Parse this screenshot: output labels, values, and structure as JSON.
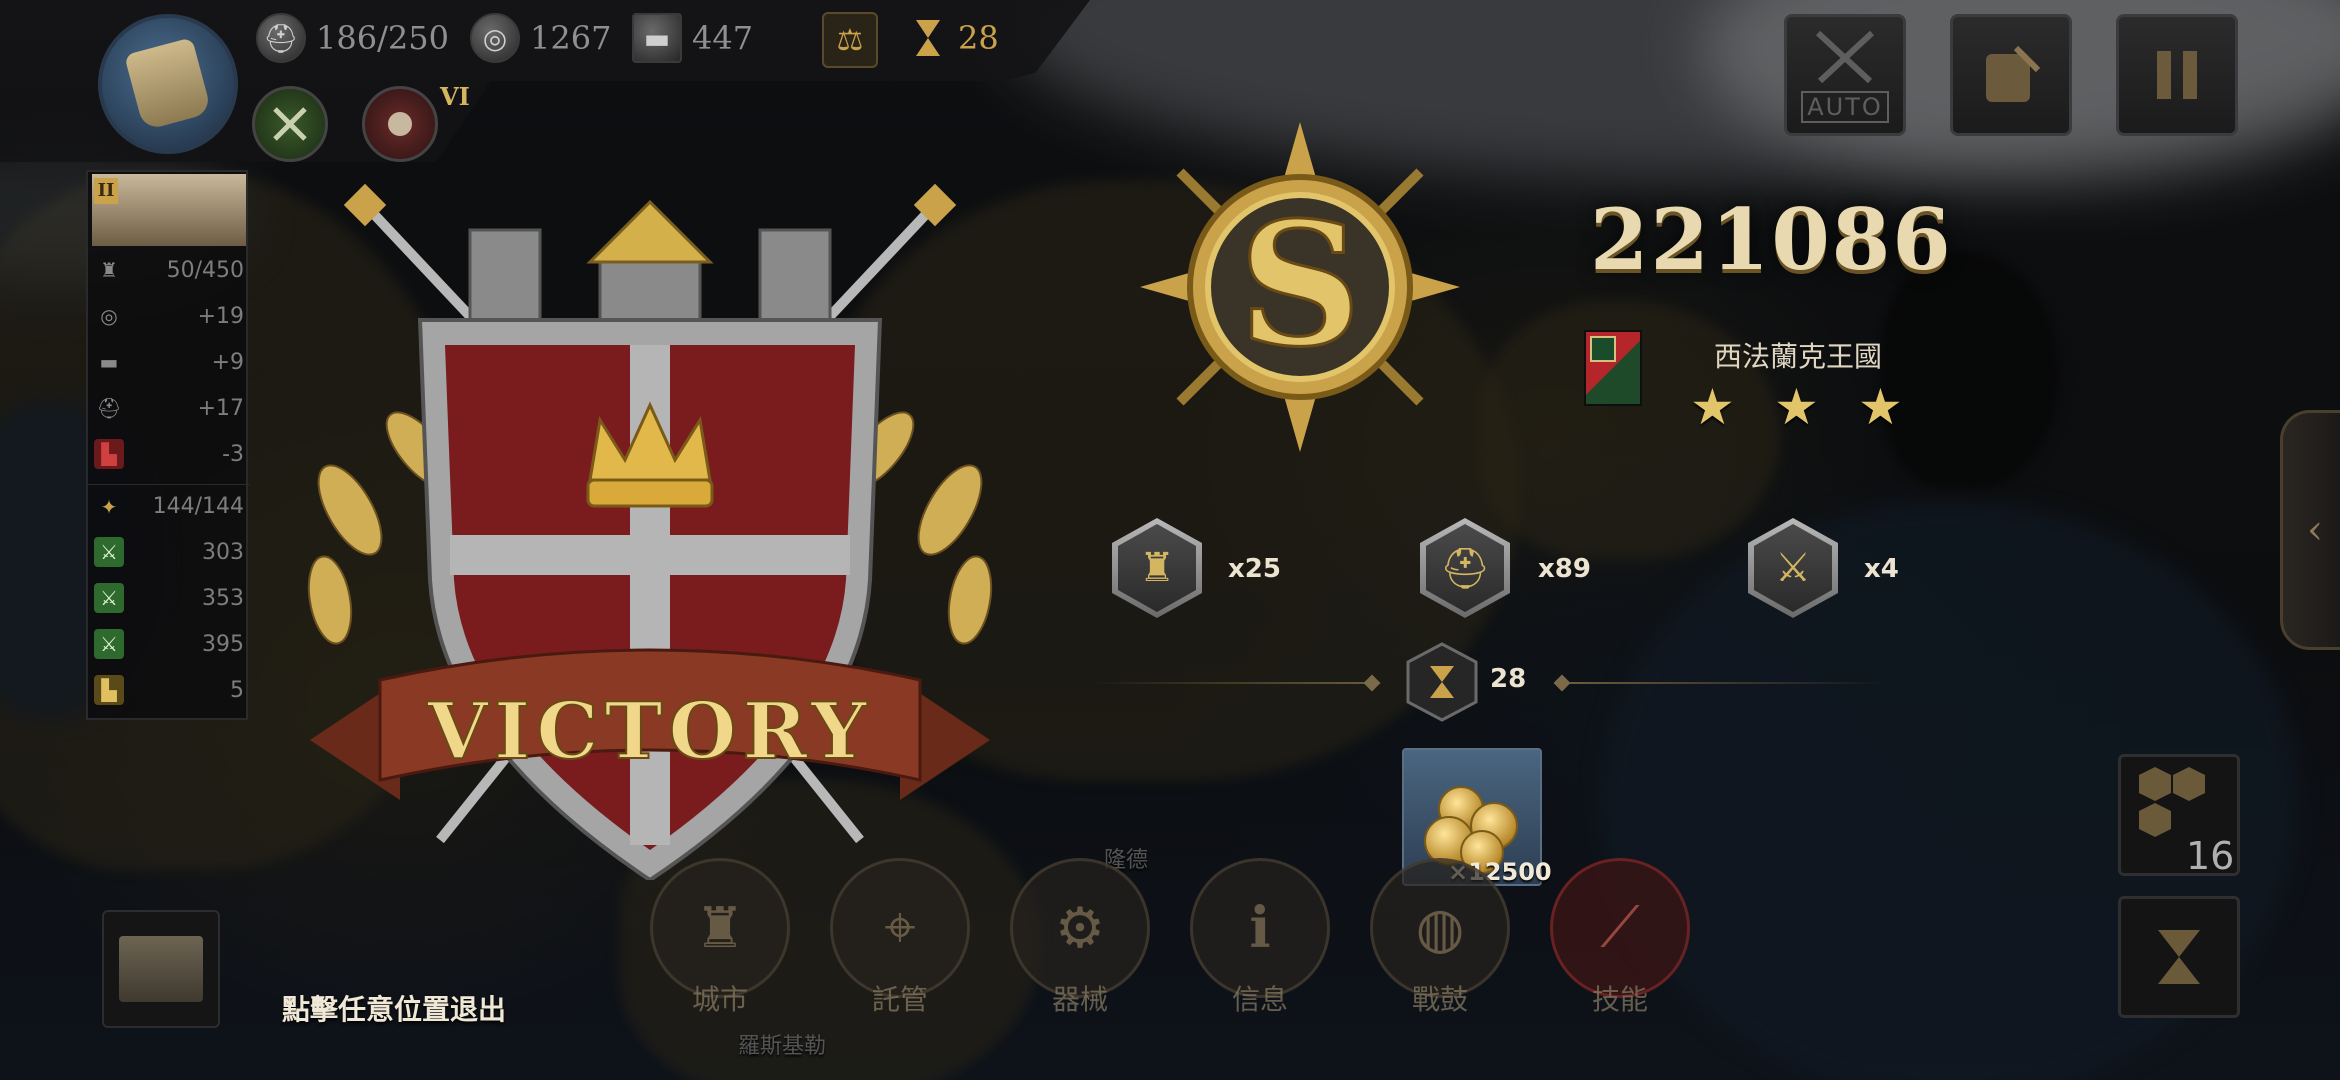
{
  "top_bar": {
    "resources": [
      {
        "icon": "helmet-icon",
        "value": "186/250"
      },
      {
        "icon": "silver-coin-icon",
        "value": "1267"
      },
      {
        "icon": "iron-ingot-icon",
        "value": "447"
      }
    ],
    "turn": {
      "icon": "hourglass-icon",
      "value": "28"
    },
    "hero_rank": "VI"
  },
  "top_right": {
    "auto_label": "AUTO"
  },
  "left_panel": {
    "level": "II",
    "stats": [
      {
        "icon": "castle-icon",
        "value": "50/450"
      },
      {
        "icon": "coin-icon",
        "value": "+19"
      },
      {
        "icon": "ingot-icon",
        "value": "+9"
      },
      {
        "icon": "helmet-icon",
        "value": "+17"
      },
      {
        "icon": "boot-icon",
        "value": "-3"
      },
      {
        "icon": "eagle-icon",
        "value": "144/144"
      },
      {
        "icon": "sword-icon",
        "value": "303"
      },
      {
        "icon": "sword-icon",
        "value": "353"
      },
      {
        "icon": "sword-icon",
        "value": "395"
      },
      {
        "icon": "boot-icon",
        "value": "5"
      }
    ]
  },
  "victory": {
    "banner": "VICTORY",
    "score": "221086",
    "kingdom": "西法蘭克王國",
    "stars": 3
  },
  "rewards": [
    {
      "icon": "cathedral-icon",
      "count": "x25"
    },
    {
      "icon": "spartan-helmet-icon",
      "count": "x89"
    },
    {
      "icon": "crossed-swords-icon",
      "count": "x4"
    }
  ],
  "turn_count": "28",
  "gold_reward": "×12500",
  "actions": [
    {
      "icon": "city-icon",
      "label": "城市"
    },
    {
      "icon": "map-pin-icon",
      "label": "託管"
    },
    {
      "icon": "catapult-icon",
      "label": "器械"
    },
    {
      "icon": "info-icon",
      "label": "信息"
    },
    {
      "icon": "drum-icon",
      "label": "戰鼓"
    },
    {
      "icon": "spear-icon",
      "label": "技能"
    }
  ],
  "exit_hint": "點擊任意位置退出",
  "hexgrid_count": "16",
  "map_labels": {
    "town_a": "隆德",
    "town_b": "羅斯基勒"
  },
  "colors": {
    "gold": "#e2c56a",
    "shield_red": "#7a1c1e",
    "panel_bg": "#141415"
  }
}
